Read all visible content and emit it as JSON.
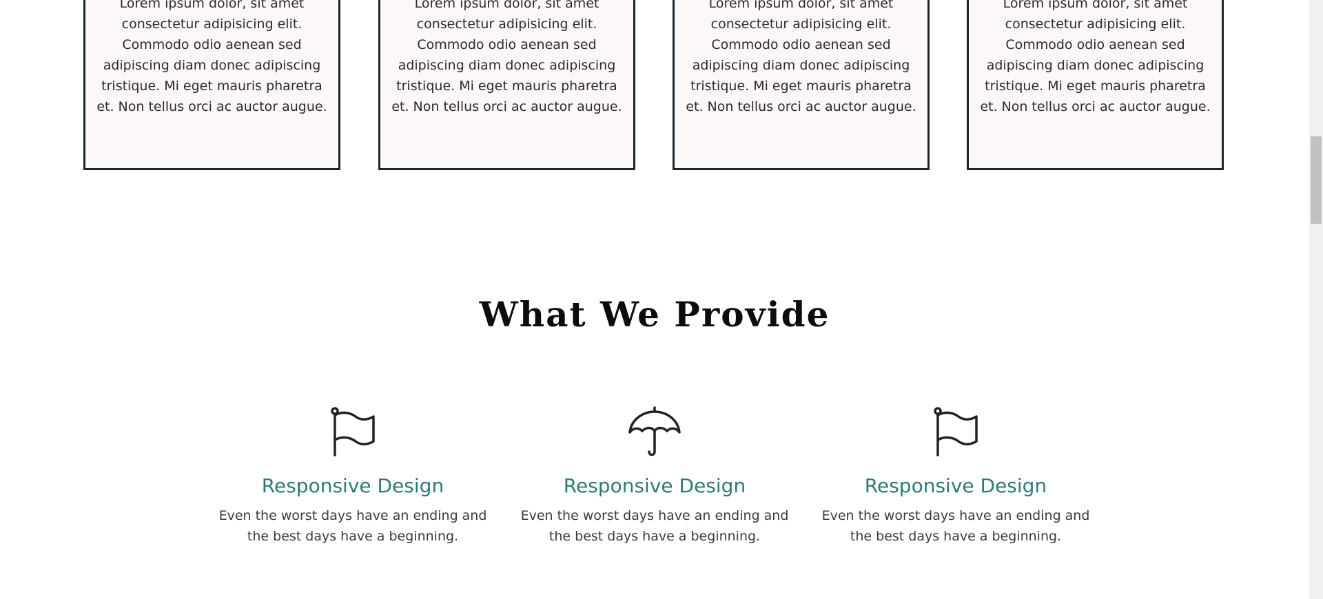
{
  "cards": [
    {
      "text": "Lorem ipsum dolor, sit amet consectetur adipisicing elit. Commodo odio aenean sed adipiscing diam donec adipiscing tristique. Mi eget mauris pharetra et. Non tellus orci ac auctor augue."
    },
    {
      "text": "Lorem ipsum dolor, sit amet consectetur adipisicing elit. Commodo odio aenean sed adipiscing diam donec adipiscing tristique. Mi eget mauris pharetra et. Non tellus orci ac auctor augue."
    },
    {
      "text": "Lorem ipsum dolor, sit amet consectetur adipisicing elit. Commodo odio aenean sed adipiscing diam donec adipiscing tristique. Mi eget mauris pharetra et. Non tellus orci ac auctor augue."
    },
    {
      "text": "Lorem ipsum dolor, sit amet consectetur adipisicing elit. Commodo odio aenean sed adipiscing diam donec adipiscing tristique. Mi eget mauris pharetra et. Non tellus orci ac auctor augue."
    }
  ],
  "provide": {
    "title": "What We Provide",
    "items": [
      {
        "icon": "flag-icon",
        "title": "Responsive Design",
        "desc": "Even the worst days have an ending and the best days have a beginning."
      },
      {
        "icon": "umbrella-icon",
        "title": "Responsive Design",
        "desc": "Even the worst days have an ending and the best days have a beginning."
      },
      {
        "icon": "flag-icon",
        "title": "Responsive Design",
        "desc": "Even the worst days have an ending and the best days have a beginning."
      }
    ]
  },
  "colors": {
    "accent": "#2c7a78",
    "card_bg": "#fcf8f7",
    "card_border": "#1c232a",
    "icon_stroke": "#1c232a"
  }
}
